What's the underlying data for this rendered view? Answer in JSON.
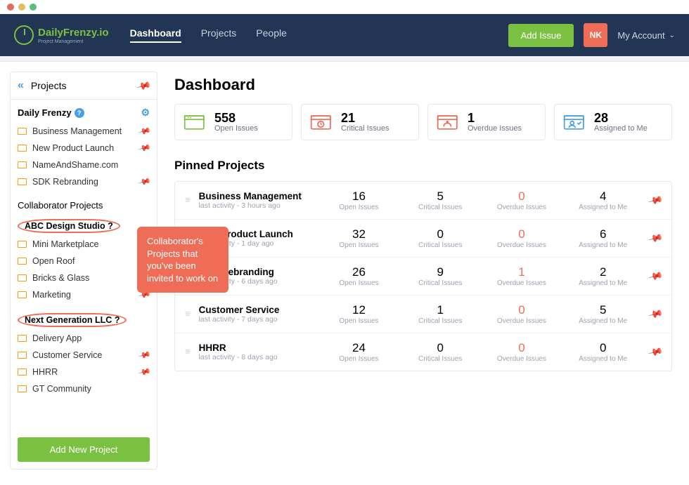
{
  "brand": {
    "name_a": "Daily",
    "name_b": "Frenzy",
    "name_c": ".io",
    "tag": "Project Management"
  },
  "nav": {
    "dashboard": "Dashboard",
    "projects": "Projects",
    "people": "People"
  },
  "header": {
    "add_issue": "Add Issue",
    "avatar": "NK",
    "my_account": "My Account"
  },
  "sidebar": {
    "title": "Projects",
    "org_title": "Daily Frenzy",
    "own": [
      {
        "name": "Business Management",
        "pinned": true
      },
      {
        "name": "New Product Launch",
        "pinned": true
      },
      {
        "name": "NameAndShame.com",
        "pinned": false
      },
      {
        "name": "SDK Rebranding",
        "pinned": true
      }
    ],
    "collab_title": "Collaborator Projects",
    "collab_a_title": "ABC Design Studio",
    "collab_a": [
      {
        "name": "Mini Marketplace",
        "pinned": false
      },
      {
        "name": "Open Roof",
        "pinned": false
      },
      {
        "name": "Bricks & Glass",
        "pinned": false
      },
      {
        "name": "Marketing",
        "pinned": true
      }
    ],
    "collab_b_title": "Next Generation LLC",
    "collab_b": [
      {
        "name": "Delivery App",
        "pinned": false
      },
      {
        "name": "Customer Service",
        "pinned": true
      },
      {
        "name": "HHRR",
        "pinned": true
      },
      {
        "name": "GT Community",
        "pinned": false
      }
    ],
    "add_button": "Add New Project"
  },
  "callout": "Collaborator's Projects that you've been invited to work on",
  "dashboard": {
    "title": "Dashboard",
    "stats": [
      {
        "value": "558",
        "label": "Open Issues",
        "color": "#7ac142"
      },
      {
        "value": "21",
        "label": "Critical Issues",
        "color": "#ef6c57"
      },
      {
        "value": "1",
        "label": "Overdue Issues",
        "color": "#ef6c57"
      },
      {
        "value": "28",
        "label": "Assigned to Me",
        "color": "#4a9fe0"
      }
    ],
    "pinned_title": "Pinned Projects",
    "col_labels": {
      "open": "Open Issues",
      "critical": "Critical Issues",
      "overdue": "Overdue Issues",
      "assigned": "Assigned to Me"
    },
    "pinned": [
      {
        "name": "Business Management",
        "activity": "last activity - 3 hours ago",
        "open": "16",
        "critical": "5",
        "overdue": "0",
        "assigned": "4"
      },
      {
        "name": "New Product Launch",
        "activity": "last activity - 1 day ago",
        "open": "32",
        "critical": "0",
        "overdue": "0",
        "assigned": "6"
      },
      {
        "name": "SDK Rebranding",
        "activity": "last activity - 6 days ago",
        "open": "26",
        "critical": "9",
        "overdue": "1",
        "assigned": "2"
      },
      {
        "name": "Customer Service",
        "activity": "last activity - 7 days ago",
        "open": "12",
        "critical": "1",
        "overdue": "0",
        "assigned": "5"
      },
      {
        "name": "HHRR",
        "activity": "last activity - 8 days ago",
        "open": "24",
        "critical": "0",
        "overdue": "0",
        "assigned": "0"
      }
    ]
  }
}
